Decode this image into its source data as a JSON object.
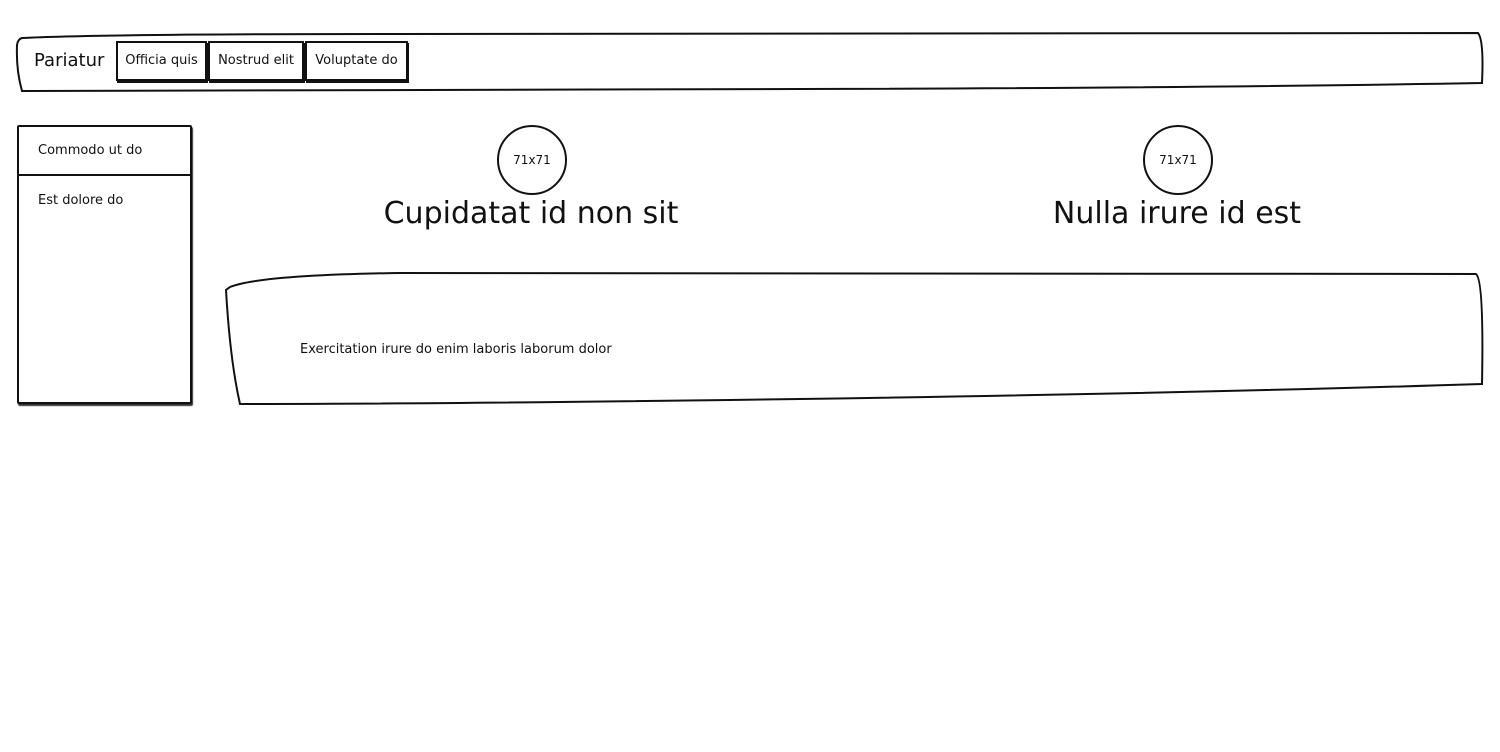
{
  "header": {
    "brand": "Pariatur",
    "nav": [
      {
        "label": "Officia quis"
      },
      {
        "label": "Nostrud elit"
      },
      {
        "label": "Voluptate do"
      }
    ]
  },
  "sidebar": {
    "items": [
      {
        "label": "Commodo ut do"
      },
      {
        "label": "Est dolore do"
      }
    ]
  },
  "features": [
    {
      "image_label": "71x71",
      "title": "Cupidatat id non sit"
    },
    {
      "image_label": "71x71",
      "title": "Nulla irure id est"
    }
  ],
  "main": {
    "text": "Exercitation irure do enim laboris laborum dolor"
  }
}
